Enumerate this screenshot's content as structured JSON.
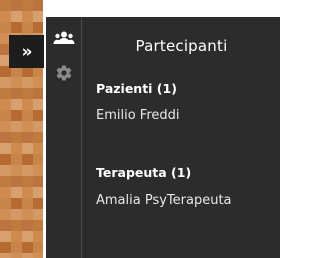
{
  "video": {
    "pixels": [
      {
        "c": "#c17a3d"
      },
      {
        "c": "#a65a2a"
      },
      {
        "c": "#d08f55"
      },
      {
        "c": "#e0a878"
      },
      {
        "c": "#b66b33"
      },
      {
        "c": "#9a4f24"
      },
      {
        "c": "#cf8a4e"
      },
      {
        "c": "#e5b38b"
      },
      {
        "c": "#bb7440"
      },
      {
        "c": "#a35c2e"
      },
      {
        "c": "#d39a68"
      },
      {
        "c": "#f0c7a3"
      },
      {
        "c": "#c88549"
      },
      {
        "c": "#ae6534"
      },
      {
        "c": "#d6a071"
      },
      {
        "c": "#e9bd96"
      }
    ]
  },
  "toolbar": {
    "expand_label": "»",
    "people_icon": "people-icon",
    "settings_icon": "gear-icon"
  },
  "colors": {
    "panel_bg": "#2c2c2c",
    "text": "#ffffff",
    "video_skin": "#b26a33"
  },
  "panel": {
    "title": "Partecipanti",
    "groups": [
      {
        "title": "Pazienti (1)",
        "members": [
          "Emilio Freddi"
        ]
      },
      {
        "title": "Terapeuta (1)",
        "members": [
          "Amalia PsyTerapeuta"
        ]
      }
    ]
  }
}
